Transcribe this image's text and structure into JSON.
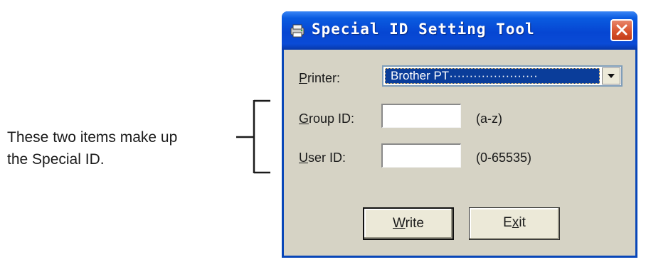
{
  "annotation": {
    "line1": "These two items make up",
    "line2": "the Special ID."
  },
  "window": {
    "title": "Special ID Setting Tool",
    "close_icon": "close-x-icon",
    "app_icon": "printer-app-icon"
  },
  "form": {
    "printer_label_mnemonic": "P",
    "printer_label_rest": "rinter:",
    "printer_value": "Brother PT······················",
    "group_label_mnemonic": "G",
    "group_label_rest": "roup ID:",
    "group_value": "",
    "group_hint": "(a-z)",
    "user_label_mnemonic": "U",
    "user_label_rest": "ser ID:",
    "user_value": "",
    "user_hint": "(0-65535)"
  },
  "buttons": {
    "write_mnemonic": "W",
    "write_rest": "rite",
    "exit_pre": "E",
    "exit_mnemonic": "x",
    "exit_rest": "it"
  },
  "colors": {
    "titlebar": "#0646d2",
    "dialog_bg": "#d6d3c5",
    "selection": "#0a3d9a",
    "close": "#d8542e"
  }
}
